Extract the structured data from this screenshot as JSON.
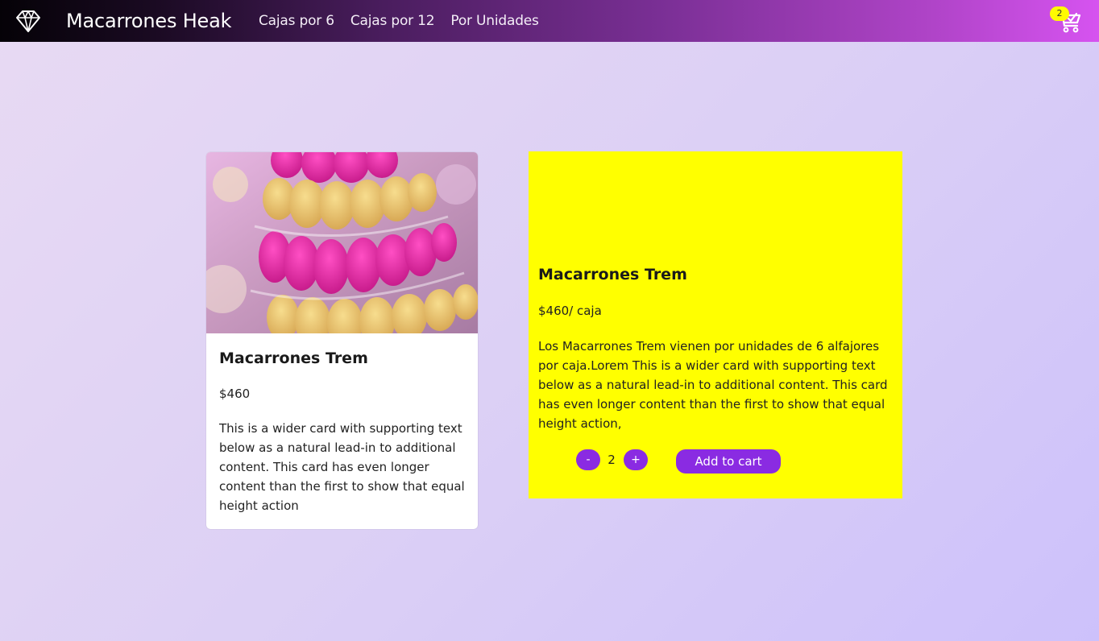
{
  "navbar": {
    "brand_icon": "diamond-icon",
    "brand_name": "Macarrones Heak",
    "links": [
      "Cajas por 6",
      "Cajas por 12",
      "Por Unidades"
    ],
    "cart_icon": "shopping-cart-icon",
    "cart_count": "2"
  },
  "product_card": {
    "image": "macaron-tower-photo",
    "title": "Macarrones Trem",
    "price": "$460",
    "text": "This is a wider card with supporting text below as a natural lead-in to additional content. This card has even longer content than the first to show that equal height action"
  },
  "detail_card": {
    "title": "Macarrones Trem",
    "price": "$460/ caja",
    "description": "Los Macarrones Trem vienen por unidades de 6 alfajores por caja.Lorem This is a wider card with supporting text below as a natural lead-in to additional content. This card has even longer content than the first to show that equal height action,",
    "minus_label": "-",
    "quantity": "2",
    "plus_label": "+",
    "add_to_cart_label": "Add to cart"
  },
  "colors": {
    "accent": "#8a2be2",
    "detail_bg": "#ffff00",
    "badge": "#fffb00"
  }
}
